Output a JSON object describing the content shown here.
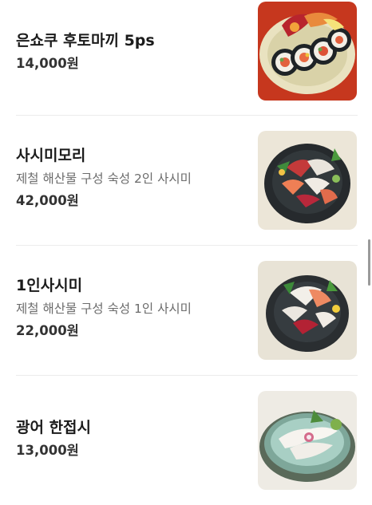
{
  "menu": {
    "items": [
      {
        "name": "은쇼쿠 후토마끼 5ps",
        "description": "",
        "price": "14,000원",
        "image_icon": "futomaki-photo"
      },
      {
        "name": "사시미모리",
        "description": "제철 해산물 구성 숙성 2인 사시미",
        "price": "42,000원",
        "image_icon": "sashimi-platter-2-photo"
      },
      {
        "name": "1인사시미",
        "description": "제철 해산물 구성 숙성 1인 사시미",
        "price": "22,000원",
        "image_icon": "sashimi-platter-1-photo"
      },
      {
        "name": "광어 한접시",
        "description": "",
        "price": "13,000원",
        "image_icon": "flatfish-plate-photo"
      }
    ]
  },
  "colors": {
    "divider": "#ececec",
    "price_text": "#333333",
    "description_text": "#6b6b6b"
  }
}
